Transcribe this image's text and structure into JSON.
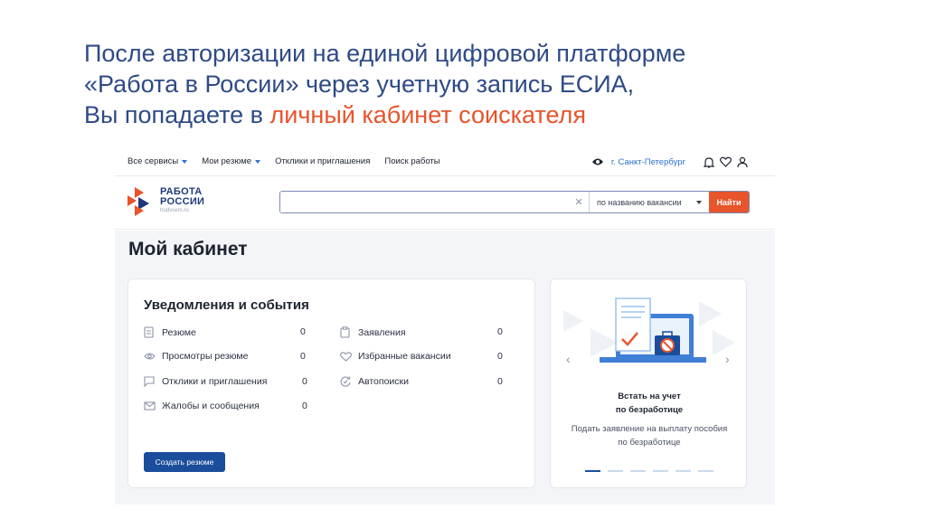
{
  "slide": {
    "heading_line1": "После авторизации на единой цифровой платформе",
    "heading_line2": "«Работа в России» через учетную запись ЕСИА,",
    "heading_line3_prefix": "Вы попадаете в ",
    "heading_line3_accent": "личный кабинет соискателя"
  },
  "topnav": {
    "items": [
      "Все сервисы",
      "Мои резюме",
      "Отклики и приглашения",
      "Поиск работы"
    ],
    "city": "г. Санкт-Петербург"
  },
  "logo": {
    "line1": "РАБОТА",
    "line2": "РОССИИ",
    "line3": "trudvsem.ru"
  },
  "search": {
    "value": "",
    "placeholder": "",
    "select_value": "по названию вакансии",
    "button_label": "Найти"
  },
  "page_title": "Мой кабинет",
  "notifications": {
    "title": "Уведомления и события",
    "left": [
      {
        "label": "Резюме",
        "count": "0",
        "icon": "document-icon"
      },
      {
        "label": "Просмотры резюме",
        "count": "0",
        "icon": "eye-icon"
      },
      {
        "label": "Отклики и приглашения",
        "count": "0",
        "icon": "chat-icon"
      },
      {
        "label": "Жалобы и сообщения",
        "count": "0",
        "icon": "mail-icon"
      }
    ],
    "right": [
      {
        "label": "Заявления",
        "count": "0",
        "icon": "clipboard-icon"
      },
      {
        "label": "Избранные вакансии",
        "count": "0",
        "icon": "heart-icon"
      },
      {
        "label": "Автопоиски",
        "count": "0",
        "icon": "autosearch-icon"
      }
    ],
    "create_button": "Создать резюме"
  },
  "promo": {
    "title_line1": "Встать на учет",
    "title_line2": "по безработице",
    "desc_line1": "Подать заявление на выплату пособия",
    "desc_line2": "по безработице",
    "slide_count": 6,
    "active_slide": 1
  },
  "colors": {
    "heading": "#2e4a86",
    "accent": "#e8542b",
    "brand_blue": "#1a4d9c",
    "link_blue": "#2f6fd0"
  }
}
